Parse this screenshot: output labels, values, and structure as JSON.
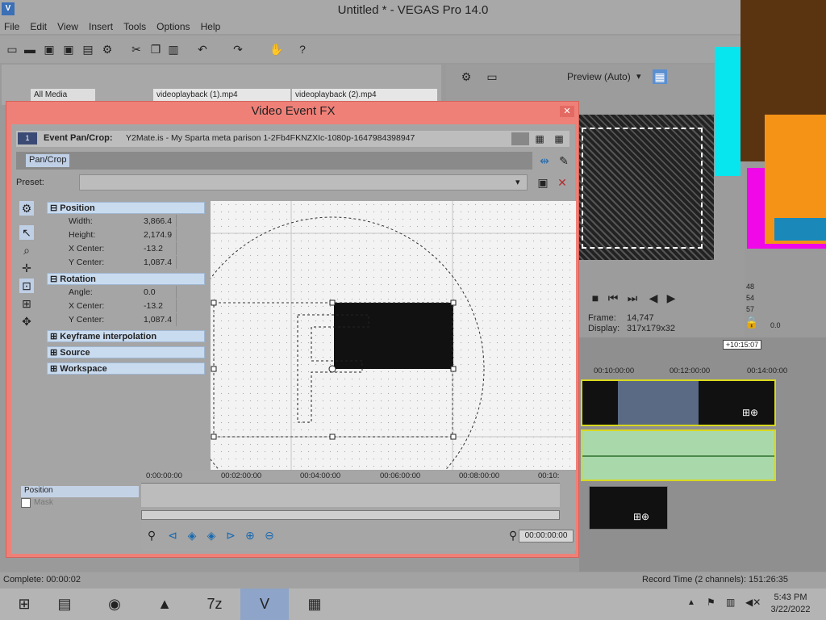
{
  "window": {
    "title": "Untitled * - VEGAS Pro 14.0"
  },
  "menu": [
    "File",
    "Edit",
    "View",
    "Insert",
    "Tools",
    "Options",
    "Help"
  ],
  "explorer": {
    "all_media": "All Media",
    "tab1": "videoplayback (1).mp4",
    "tab2": "videoplayback (2).mp4"
  },
  "preview": {
    "mode": "Preview (Auto)",
    "frame_label": "Frame:",
    "frame_value": "14,747",
    "display_label": "Display:",
    "display_value": "317x179x32",
    "levels": [
      "48",
      "54",
      "57"
    ],
    "level_left": "0.0",
    "level_right": "0.0"
  },
  "timeline": {
    "cursor": "+10:15:07",
    "ruler": [
      "00:10:00:00",
      "00:12:00:00",
      "00:14:00:00"
    ]
  },
  "dialog": {
    "title": "Video Event FX",
    "header_label": "Event Pan/Crop:",
    "header_file": "Y2Mate.is - My Sparta meta parison 1-2Fb4FKNZXIc-1080p-1647984398947",
    "chain_item": "Pan/Crop",
    "preset_label": "Preset:",
    "sections": {
      "position": "Position",
      "rotation": "Rotation",
      "keyframe": "Keyframe interpolation",
      "source": "Source",
      "workspace": "Workspace"
    },
    "position_props": [
      {
        "k": "Width:",
        "v": "3,866.4"
      },
      {
        "k": "Height:",
        "v": "2,174.9"
      },
      {
        "k": "X Center:",
        "v": "-13.2"
      },
      {
        "k": "Y Center:",
        "v": "1,087.4"
      }
    ],
    "rotation_props": [
      {
        "k": "Angle:",
        "v": "0.0"
      },
      {
        "k": "X Center:",
        "v": "-13.2"
      },
      {
        "k": "Y Center:",
        "v": "1,087.4"
      }
    ],
    "tracks": {
      "position": "Position",
      "mask": "Mask"
    },
    "ruler": [
      "0:00:00:00",
      "00:02:00:00",
      "00:04:00:00",
      "00:06:00:00",
      "00:08:00:00",
      "00:10:"
    ],
    "time_display": "00:00:00:00"
  },
  "status": {
    "left": "Complete: 00:00:02",
    "right": "Record Time (2 channels): 151:26:35"
  },
  "clock": {
    "time": "5:43 PM",
    "date": "3/22/2022"
  }
}
